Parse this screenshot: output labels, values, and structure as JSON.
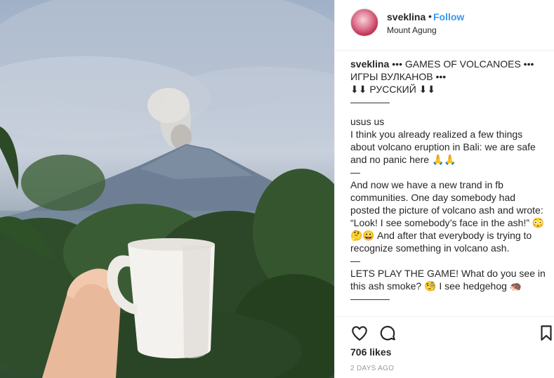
{
  "post": {
    "username": "sveklina",
    "follow_label": "Follow",
    "location": "Mount Agung",
    "caption_lines": [
      "••• GAMES OF VOLCANOES •••",
      "ИГРЫ ВУЛКАНОВ •••",
      "⬇⬇ РУССКИЙ ⬇⬇",
      "————",
      "usus us",
      "I think you already realized a few things about volcano eruption in Bali: we are safe and no panic here 🙏🙏",
      "—",
      "And now we have a new trand in fb communities. One day somebody had posted the picture of volcano ash and wrote: “Look! I see somebody’s face in the ash!” 😳🤔😀 And after that everybody is trying to recognize something in volcano ash.",
      "—",
      "LETS PLAY THE GAME! What do you see in this ash smoke? 🧐 I see hedgehog 🦔",
      "————"
    ],
    "likes": "706 likes",
    "timestamp": "2 DAYS AGO"
  },
  "icons": {
    "like": "heart-icon",
    "comment": "speech-bubble-icon",
    "save": "bookmark-icon"
  },
  "colors": {
    "link": "#3897f0",
    "text": "#262626",
    "muted": "#999999"
  }
}
